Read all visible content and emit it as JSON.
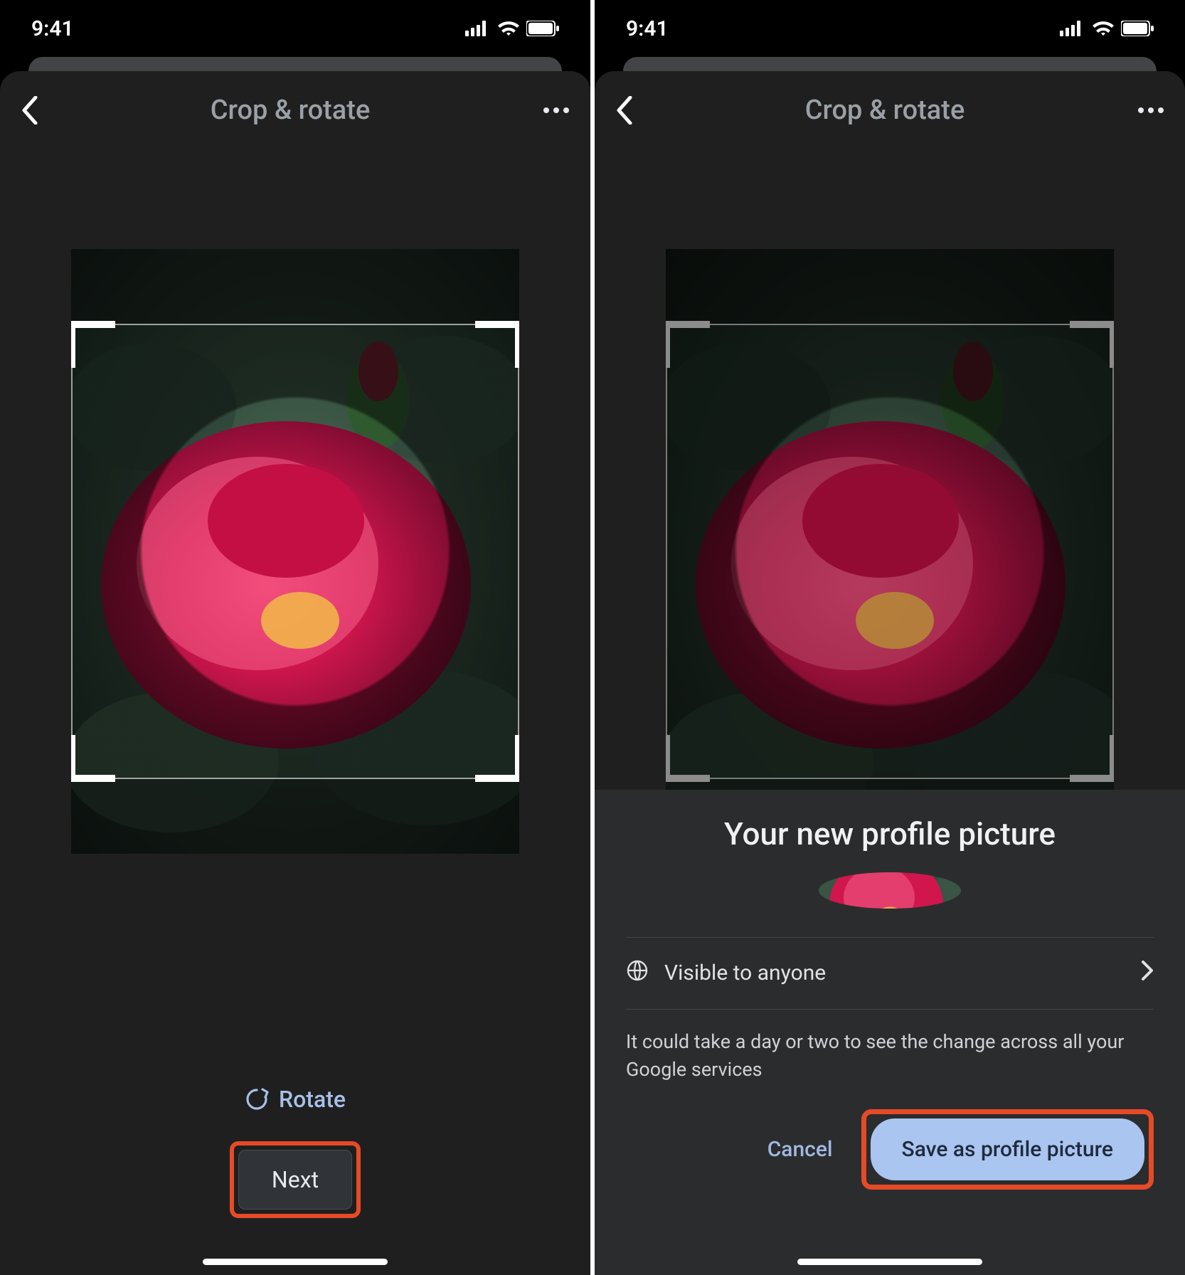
{
  "statusbar": {
    "time": "9:41"
  },
  "left": {
    "header": {
      "title": "Crop & rotate"
    },
    "buttons": {
      "rotate": "Rotate",
      "next": "Next"
    }
  },
  "right": {
    "header": {
      "title": "Crop & rotate"
    },
    "sheet": {
      "title": "Your new profile picture",
      "visibility": "Visible to anyone",
      "note": "It could take a day or two to see the change across all your Google services",
      "cancel": "Cancel",
      "save": "Save as profile picture"
    }
  }
}
